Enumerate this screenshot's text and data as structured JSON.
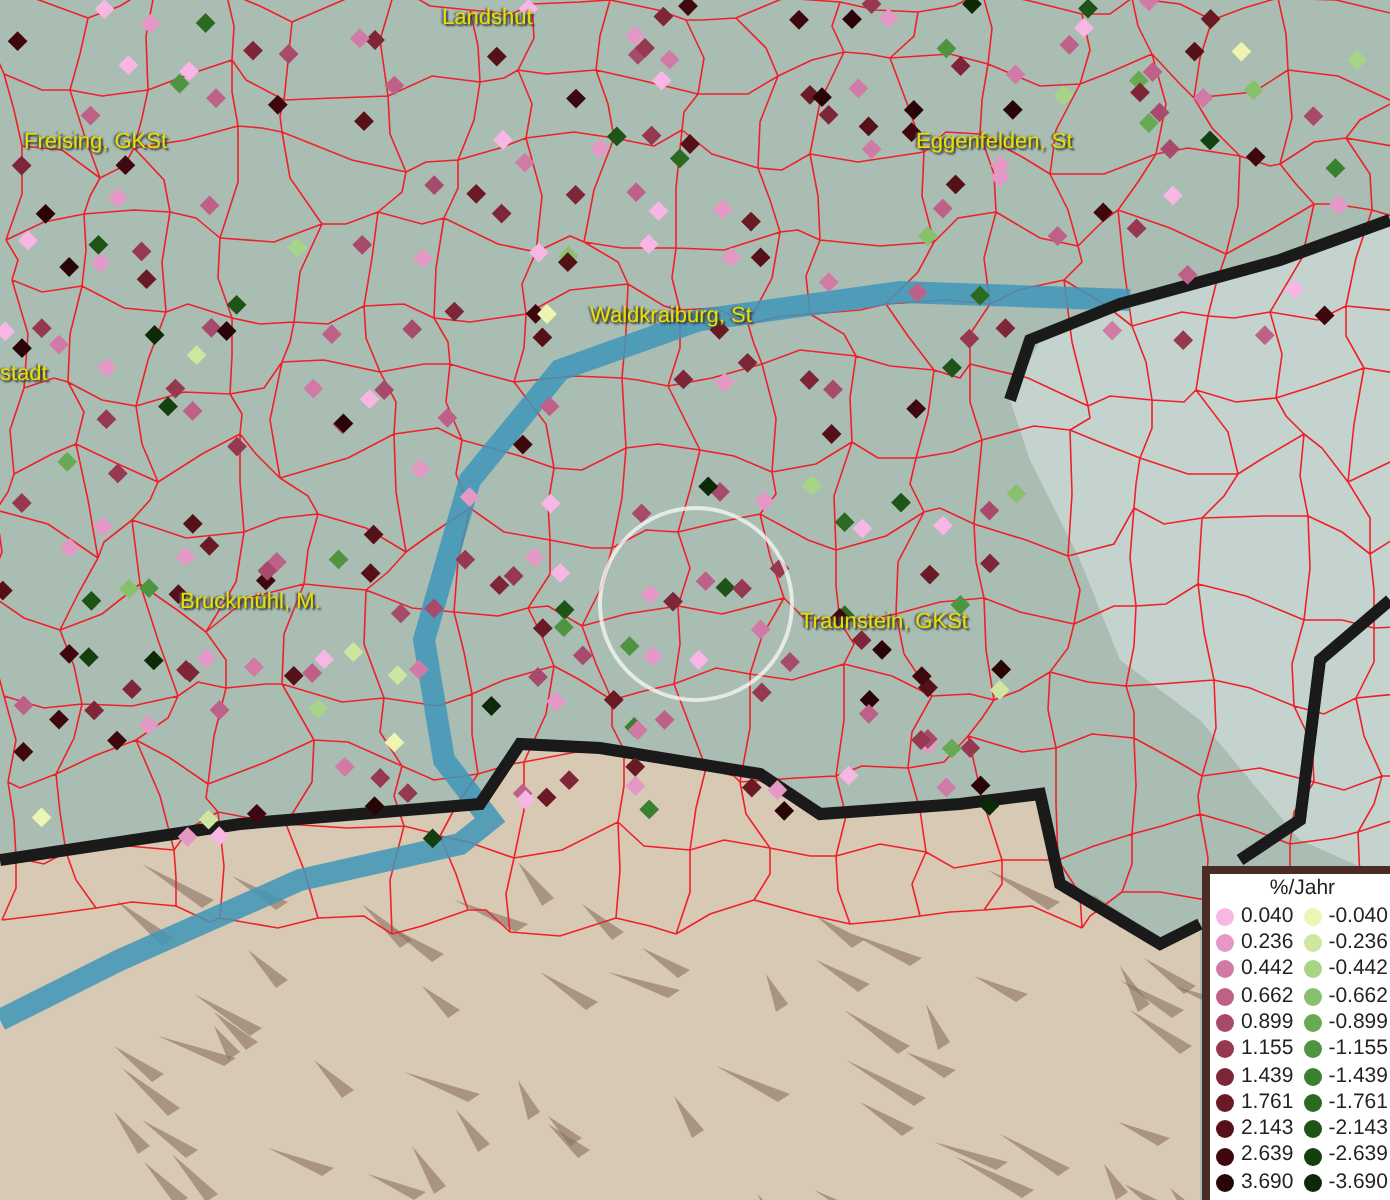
{
  "map": {
    "places": [
      {
        "name": "Landshut"
      },
      {
        "name": "Freising, GKSt"
      },
      {
        "name": "Eggenfelden, St"
      },
      {
        "name": "Waldkraiburg, St"
      },
      {
        "name": "stadt"
      },
      {
        "name": "Bruckmühl, M."
      },
      {
        "name": "Traunstein, GKSt"
      }
    ]
  },
  "legend": {
    "title": "%/Jahr",
    "positive": [
      {
        "label": "0.040",
        "color": "#f7b6e4"
      },
      {
        "label": "0.236",
        "color": "#e597c5"
      },
      {
        "label": "0.442",
        "color": "#d27aa6"
      },
      {
        "label": "0.662",
        "color": "#bf6088"
      },
      {
        "label": "0.899",
        "color": "#a84a6c"
      },
      {
        "label": "1.155",
        "color": "#96384f"
      },
      {
        "label": "1.439",
        "color": "#7e2638"
      },
      {
        "label": "1.761",
        "color": "#6a1a25"
      },
      {
        "label": "2.143",
        "color": "#561018"
      },
      {
        "label": "2.639",
        "color": "#3f080e"
      },
      {
        "label": "3.690",
        "color": "#2a0508"
      }
    ],
    "negative": [
      {
        "label": "-0.040",
        "color": "#eef5b0"
      },
      {
        "label": "-0.236",
        "color": "#cfe6a0"
      },
      {
        "label": "-0.442",
        "color": "#a8d488"
      },
      {
        "label": "-0.662",
        "color": "#88c06c"
      },
      {
        "label": "-0.899",
        "color": "#68a954"
      },
      {
        "label": "-1.155",
        "color": "#4f9440"
      },
      {
        "label": "-1.439",
        "color": "#3b7f30"
      },
      {
        "label": "-1.761",
        "color": "#2c6a22"
      },
      {
        "label": "-2.143",
        "color": "#1e5417"
      },
      {
        "label": "-2.639",
        "color": "#143f0f"
      },
      {
        "label": "-3.690",
        "color": "#0c2a08"
      }
    ]
  }
}
